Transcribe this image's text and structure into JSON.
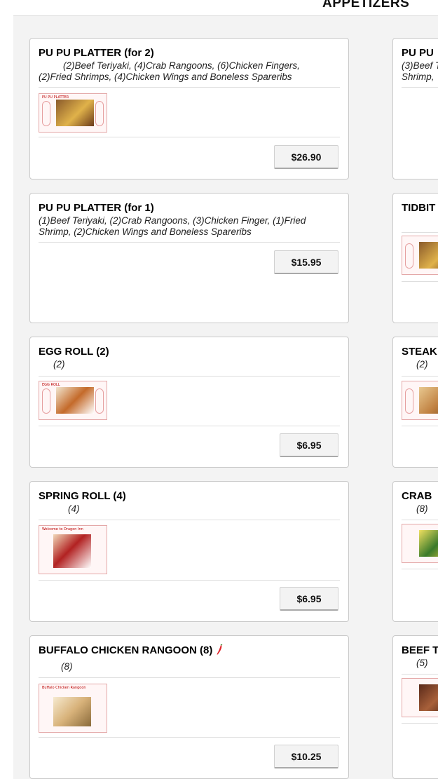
{
  "section_title": "APPETIZERS",
  "left_items": [
    {
      "title": "PU PU PLATTER (for 2)",
      "desc": "(2)Beef Teriyaki, (4)Crab Rangoons, (6)Chicken Fingers, (2)Fried Shrimps, (4)Chicken Wings and Boneless Spareribs",
      "price": "$26.90",
      "image_label": "PU PU PLATTER"
    },
    {
      "title": "PU PU PLATTER (for 1)",
      "desc": "(1)Beef Teriyaki, (2)Crab Rangoons, (3)Chicken Finger, (1)Fried Shrimp, (2)Chicken Wings and Boneless Spareribs",
      "price": "$15.95"
    },
    {
      "title": "EGG ROLL (2)",
      "desc": "(2)",
      "price": "$6.95",
      "image_label": "EGG ROLL"
    },
    {
      "title": "SPRING ROLL (4)",
      "desc": "(4)",
      "price": "$6.95",
      "image_label": "Welcome to Dragon Inn"
    },
    {
      "title": "BUFFALO CHICKEN RANGOON (8)",
      "desc": "(8)",
      "price": "$10.25",
      "image_label": "Buffalo Chicken Rangoon",
      "spicy": true
    }
  ],
  "right_items": [
    {
      "title": "PU PU",
      "desc": "(3)Beef T Shrimp,"
    },
    {
      "title": "TIDBIT"
    },
    {
      "title": "STEAK",
      "desc": "(2)"
    },
    {
      "title": "CRAB",
      "desc": "(8)"
    },
    {
      "title": "BEEF T",
      "desc": "(5)"
    }
  ],
  "colors": {
    "accent_border": "#e4a8a8",
    "chili": "#e0242a"
  }
}
